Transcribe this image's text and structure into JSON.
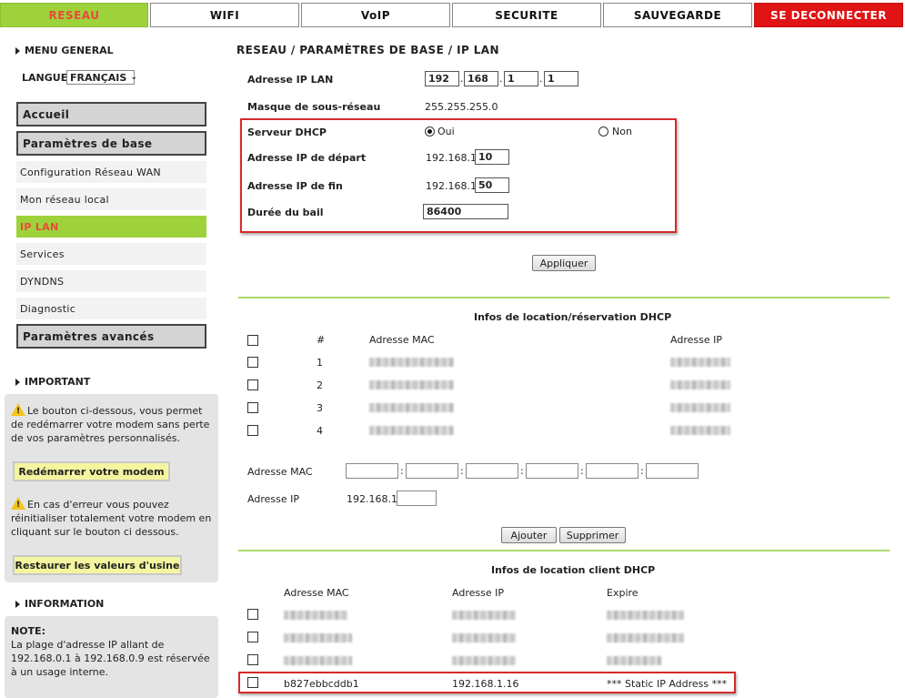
{
  "nav": {
    "tabs": [
      "RESEAU",
      "WIFI",
      "VoIP",
      "SECURITE",
      "SAUVEGARDE"
    ],
    "logout": "SE DECONNECTER"
  },
  "sidebar": {
    "menu_general": "MENU GENERAL",
    "langue_label": "LANGUE",
    "langue_value": "FRANÇAIS",
    "accueil": "Accueil",
    "parametres_base": "Paramètres de base",
    "items": [
      "Configuration Réseau WAN",
      "Mon réseau local",
      "IP LAN",
      "Services",
      "DYNDNS",
      "Diagnostic"
    ],
    "parametres_avances": "Paramètres avancés",
    "important_title": "IMPORTANT",
    "important_text1": "Le bouton ci-dessous, vous permet de redémarrer votre modem sans perte de vos paramètres personnalisés.",
    "restart_button": "Redémarrer votre modem",
    "important_text2": "En cas d'erreur vous pouvez réinitialiser totalement votre modem en cliquant sur le bouton ci dessous.",
    "restore_button": "Restaurer les valeurs d'usine",
    "information_title": "INFORMATION",
    "note_title": "NOTE:",
    "note_text": "La plage d'adresse IP allant de 192.168.0.1 à 192.168.0.9 est réservée à un usage interne."
  },
  "main": {
    "breadcrumb": "RESEAU / PARAMÈTRES DE BASE / IP LAN",
    "ip_lan_label": "Adresse IP LAN",
    "ip_octets": [
      "192",
      "168",
      "1",
      "1"
    ],
    "mask_label": "Masque de sous-réseau",
    "mask_value": "255.255.255.0",
    "dhcp_label": "Serveur DHCP",
    "dhcp_yes": "Oui",
    "dhcp_no": "Non",
    "start_label": "Adresse IP de départ",
    "start_prefix": "192.168.1.",
    "start_value": "10",
    "end_label": "Adresse IP de fin",
    "end_prefix": "192.168.1.",
    "end_value": "50",
    "lease_label": "Durée du bail",
    "lease_value": "86400",
    "apply_button": "Appliquer",
    "reservation_title": "Infos de location/réservation DHCP",
    "res_headers": [
      "#",
      "Adresse MAC",
      "Adresse IP"
    ],
    "res_rows": [
      "1",
      "2",
      "3",
      "4"
    ],
    "mac_label": "Adresse MAC",
    "ip_label": "Adresse IP",
    "ip_prefix": "192.168.1.",
    "add_button": "Ajouter",
    "delete_button": "Supprimer",
    "client_title": "Infos de location client DHCP",
    "client_headers": [
      "Adresse MAC",
      "Adresse IP",
      "Expire"
    ],
    "client_last": {
      "mac": "b827ebbcddb1",
      "ip": "192.168.1.16",
      "expire": "*** Static IP Address ***"
    }
  }
}
